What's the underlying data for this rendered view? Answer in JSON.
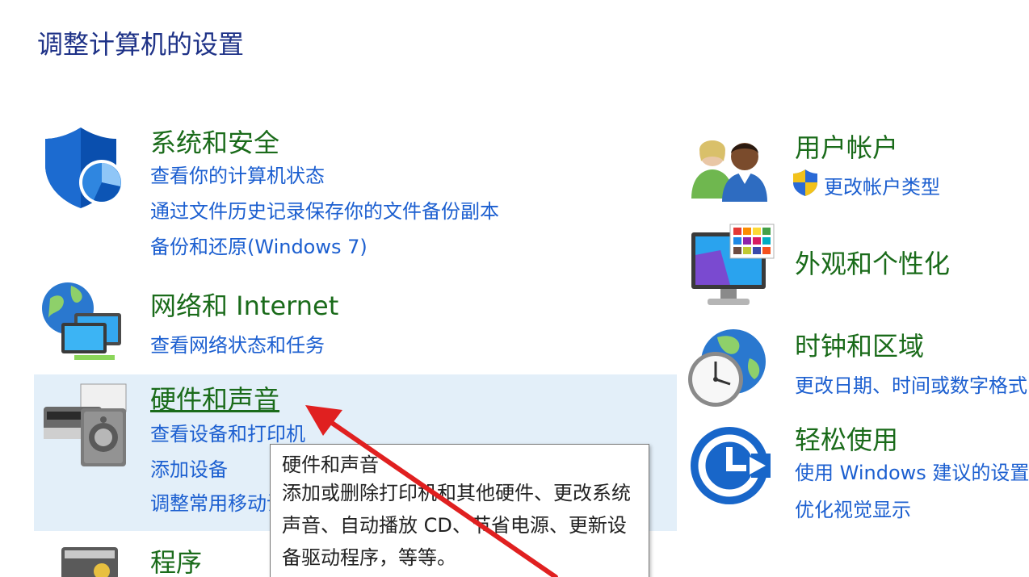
{
  "page_title": "调整计算机的设置",
  "categories": {
    "system": {
      "title": "系统和安全",
      "icon": "shield-icon",
      "links": [
        "查看你的计算机状态",
        "通过文件历史记录保存你的文件备份副本",
        "备份和还原(Windows 7)"
      ]
    },
    "network": {
      "title": "网络和 Internet",
      "icon": "network-globe-icon",
      "links": [
        "查看网络状态和任务"
      ]
    },
    "hardware": {
      "title": "硬件和声音",
      "icon": "printer-speaker-icon",
      "links": [
        "查看设备和打印机",
        "添加设备",
        "调整常用移动设置"
      ]
    },
    "programs": {
      "title": "程序",
      "icon": "programs-icon"
    },
    "users": {
      "title": "用户帐户",
      "icon": "users-icon",
      "links": [
        "更改帐户类型"
      ],
      "link_badge_icon": "uac-shield-icon"
    },
    "appearance": {
      "title": "外观和个性化",
      "icon": "monitor-palette-icon"
    },
    "clock": {
      "title": "时钟和区域",
      "icon": "clock-globe-icon",
      "links": [
        "更改日期、时间或数字格式"
      ]
    },
    "ease": {
      "title": "轻松使用",
      "icon": "ease-of-access-icon",
      "links": [
        "使用 Windows 建议的设置",
        "优化视觉显示"
      ]
    }
  },
  "tooltip": {
    "title": "硬件和声音",
    "description": "添加或删除打印机和其他硬件、更改系统声音、自动播放 CD、节省电源、更新设备驱动程序，等等。"
  },
  "colors": {
    "title_blue": "#1e3287",
    "category_green": "#1a6b1a",
    "link_blue": "#1c5fd0",
    "hover_bg": "#e3eff9",
    "annotation_red": "#e02020"
  }
}
